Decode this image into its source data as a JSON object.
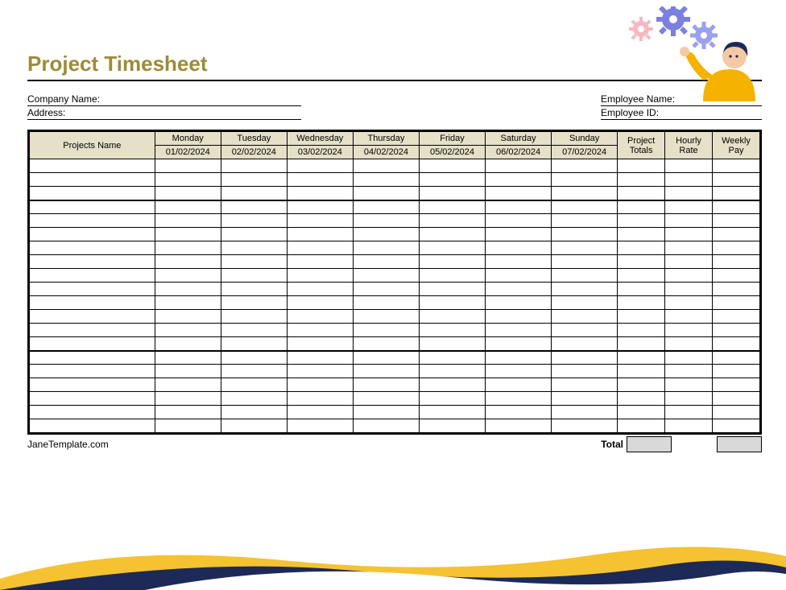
{
  "title": "Project Timesheet",
  "info": {
    "company_label": "Company Name:",
    "address_label": "Address:",
    "employee_label": "Employee Name:",
    "empid_label": "Employee ID:"
  },
  "columns": {
    "projects": "Projects Name",
    "days": [
      {
        "name": "Monday",
        "date": "01/02/2024"
      },
      {
        "name": "Tuesday",
        "date": "02/02/2024"
      },
      {
        "name": "Wednesday",
        "date": "03/02/2024"
      },
      {
        "name": "Thursday",
        "date": "04/02/2024"
      },
      {
        "name": "Friday",
        "date": "05/02/2024"
      },
      {
        "name": "Saturday",
        "date": "06/02/2024"
      },
      {
        "name": "Sunday",
        "date": "07/02/2024"
      }
    ],
    "project_totals": "Project Totals",
    "hourly_rate": "Hourly Rate",
    "weekly_pay": "Weekly Pay"
  },
  "sections": [
    3,
    11,
    6
  ],
  "footer": {
    "brand": "JaneTemplate.com",
    "total_label": "Total"
  }
}
